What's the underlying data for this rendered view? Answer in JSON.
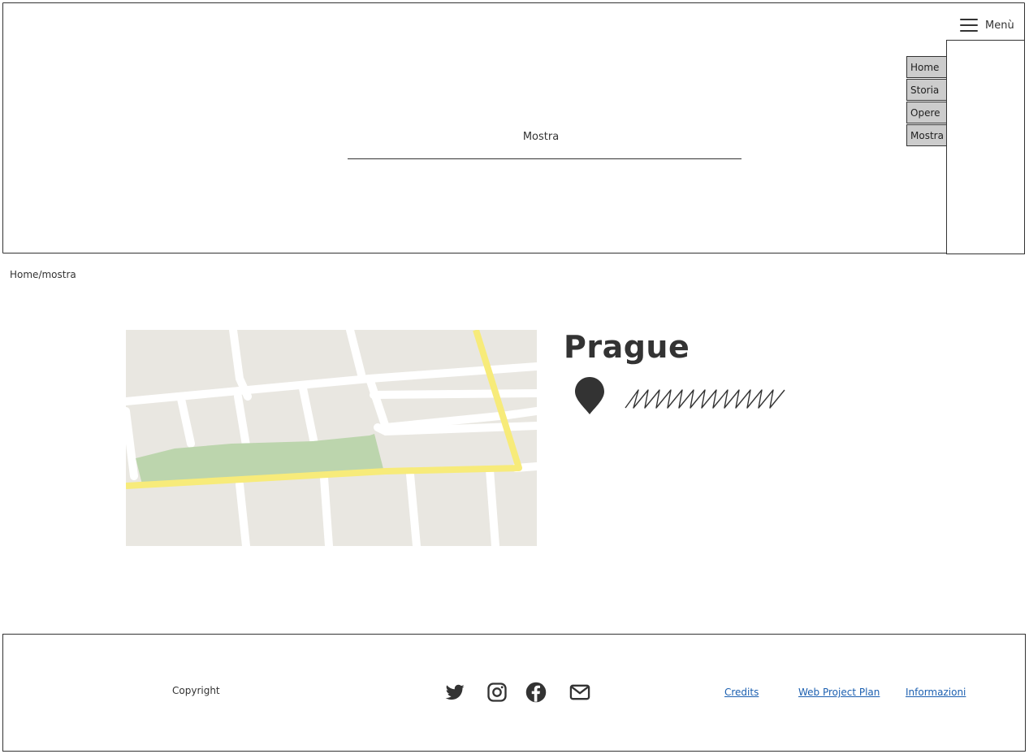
{
  "header": {
    "menu_label": "Menù",
    "hero_title": "Mostra",
    "nav_items": [
      {
        "label": "Home"
      },
      {
        "label": "Storia"
      },
      {
        "label": "Opere"
      },
      {
        "label": "Mostra"
      }
    ]
  },
  "breadcrumb": "Home/mostra",
  "location": {
    "city": "Prague",
    "pin_icon": "map-pin-icon",
    "address_placeholder": "squiggle"
  },
  "map_colors": {
    "block": "#e9e7e1",
    "street": "#ffffff",
    "main_road": "#f7eb7a",
    "park": "#bcd5ad"
  },
  "footer": {
    "copyright": "Copyright",
    "social_icons": [
      "twitter-icon",
      "instagram-icon",
      "facebook-icon",
      "mail-icon"
    ],
    "links": [
      "Credits",
      "Web Project Plan",
      "Informazioni"
    ]
  }
}
